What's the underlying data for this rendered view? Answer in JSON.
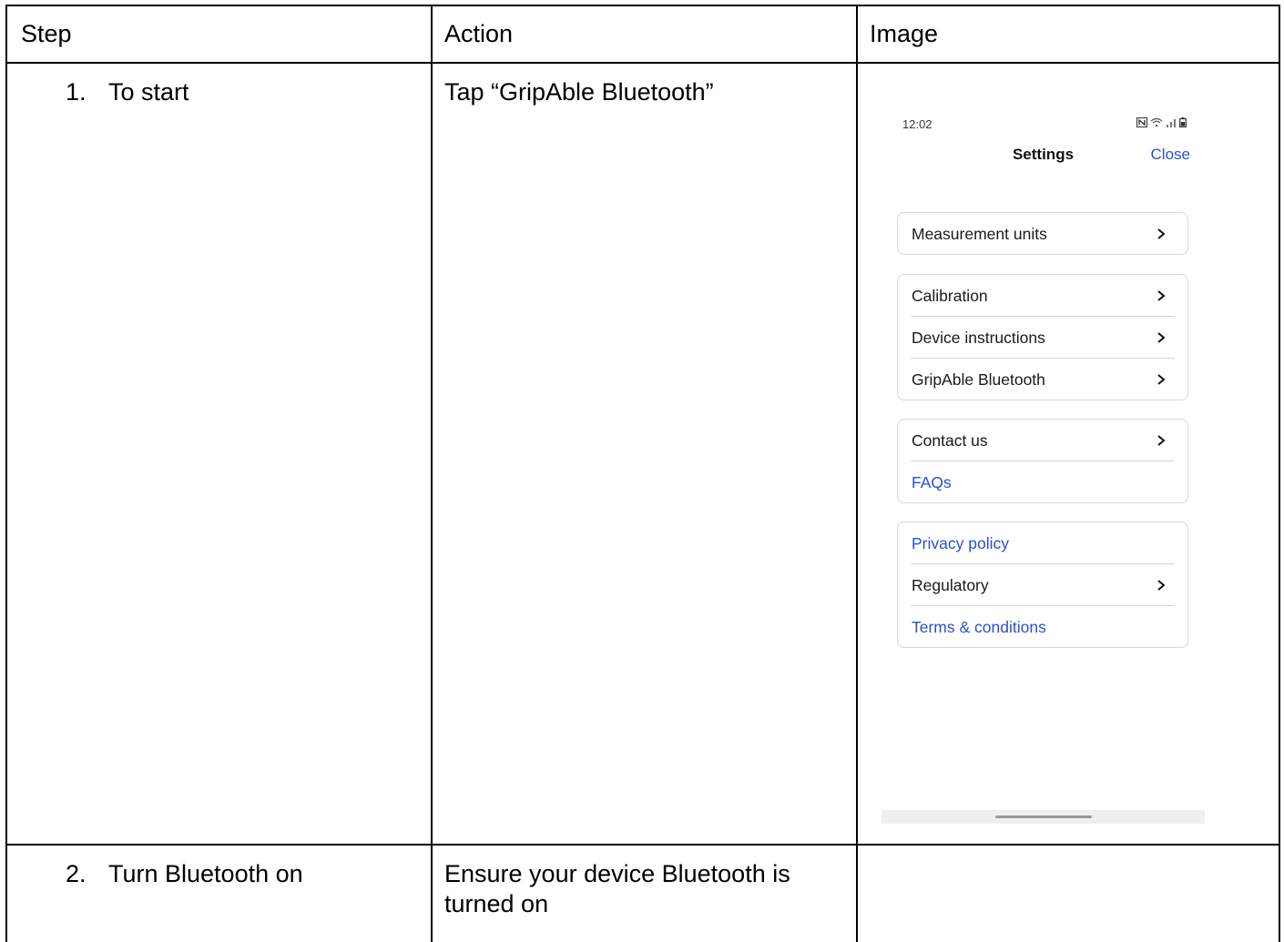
{
  "table": {
    "headers": [
      "Step",
      "Action",
      "Image"
    ],
    "rows": [
      {
        "num": "1.",
        "step": "To start",
        "action": "Tap “GripAble Bluetooth”"
      },
      {
        "num": "2.",
        "step": "Turn Bluetooth on",
        "action": "Ensure your device Bluetooth is turned on"
      }
    ]
  },
  "phone": {
    "time": "12:02",
    "title": "Settings",
    "close_label": "Close",
    "link_color": "#2a4fd1",
    "groups": [
      [
        {
          "label": "Measurement units",
          "type": "nav"
        }
      ],
      [
        {
          "label": "Calibration",
          "type": "nav"
        },
        {
          "label": "Device instructions",
          "type": "nav"
        },
        {
          "label": "GripAble Bluetooth",
          "type": "nav"
        }
      ],
      [
        {
          "label": "Contact us",
          "type": "nav"
        },
        {
          "label": "FAQs",
          "type": "link"
        }
      ],
      [
        {
          "label": "Privacy policy",
          "type": "link"
        },
        {
          "label": "Regulatory",
          "type": "nav"
        },
        {
          "label": "Terms & conditions",
          "type": "link"
        }
      ]
    ]
  }
}
